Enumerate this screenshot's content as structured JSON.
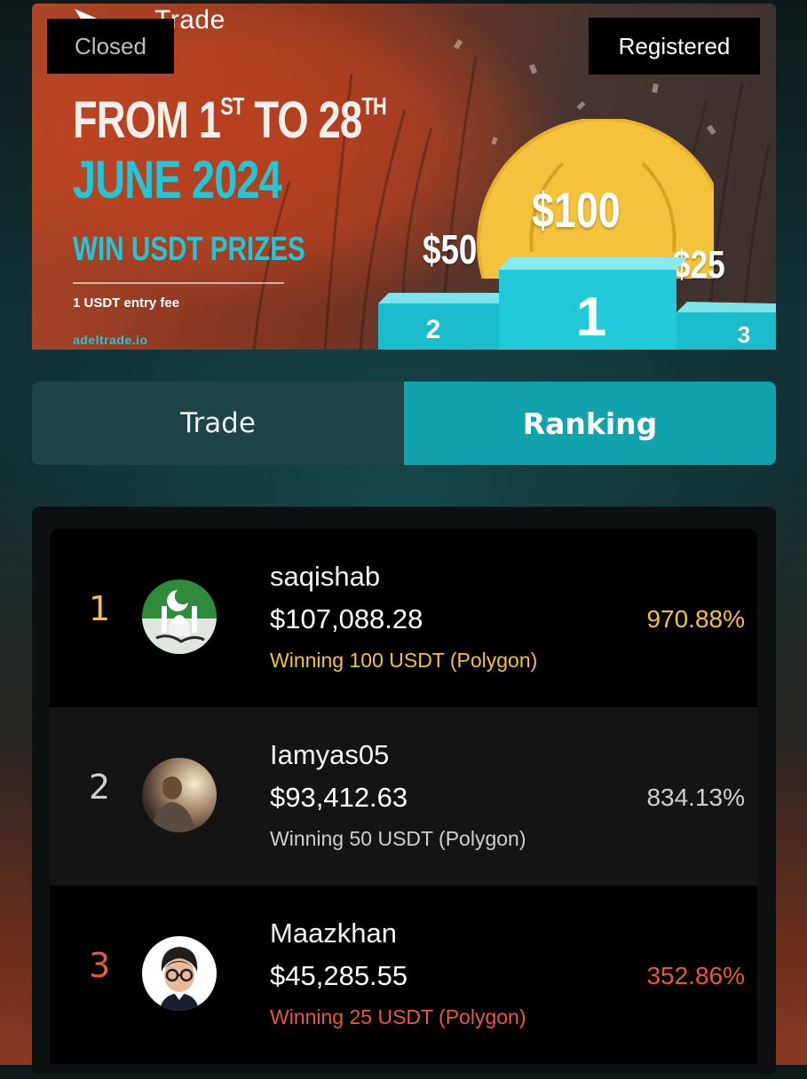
{
  "colors": {
    "gold": "#f0c144",
    "silver": "#cfcfcf",
    "bronze": "#e45a3c",
    "accent": "#11a2ad"
  },
  "banner": {
    "brand": "Trade",
    "status_closed": "Closed",
    "status_registered": "Registered",
    "headline_from": "FROM 1",
    "headline_st": "ST",
    "headline_to": " TO 28",
    "headline_th": "TH",
    "headline_date": "JUNE 2024",
    "headline_prizes": "WIN USDT PRIZES",
    "entry_fee": "1 USDT entry fee",
    "site": "adeltrade.io",
    "prize_first": "$100",
    "prize_second": "$50",
    "prize_third": "$25",
    "podium_labels": [
      "1",
      "2",
      "3"
    ]
  },
  "tabs": [
    {
      "label": "Trade",
      "active": false
    },
    {
      "label": "Ranking",
      "active": true
    }
  ],
  "ranking": [
    {
      "rank": "1",
      "username": "saqishab",
      "balance": "$107,088.28",
      "winning": "Winning 100 USDT (Polygon)",
      "percent": "970.88%",
      "color": "gold"
    },
    {
      "rank": "2",
      "username": "Iamyas05",
      "balance": "$93,412.63",
      "winning": "Winning 50 USDT (Polygon)",
      "percent": "834.13%",
      "color": "silver"
    },
    {
      "rank": "3",
      "username": "Maazkhan",
      "balance": "$45,285.55",
      "winning": "Winning 25 USDT (Polygon)",
      "percent": "352.86%",
      "color": "bronze"
    }
  ]
}
